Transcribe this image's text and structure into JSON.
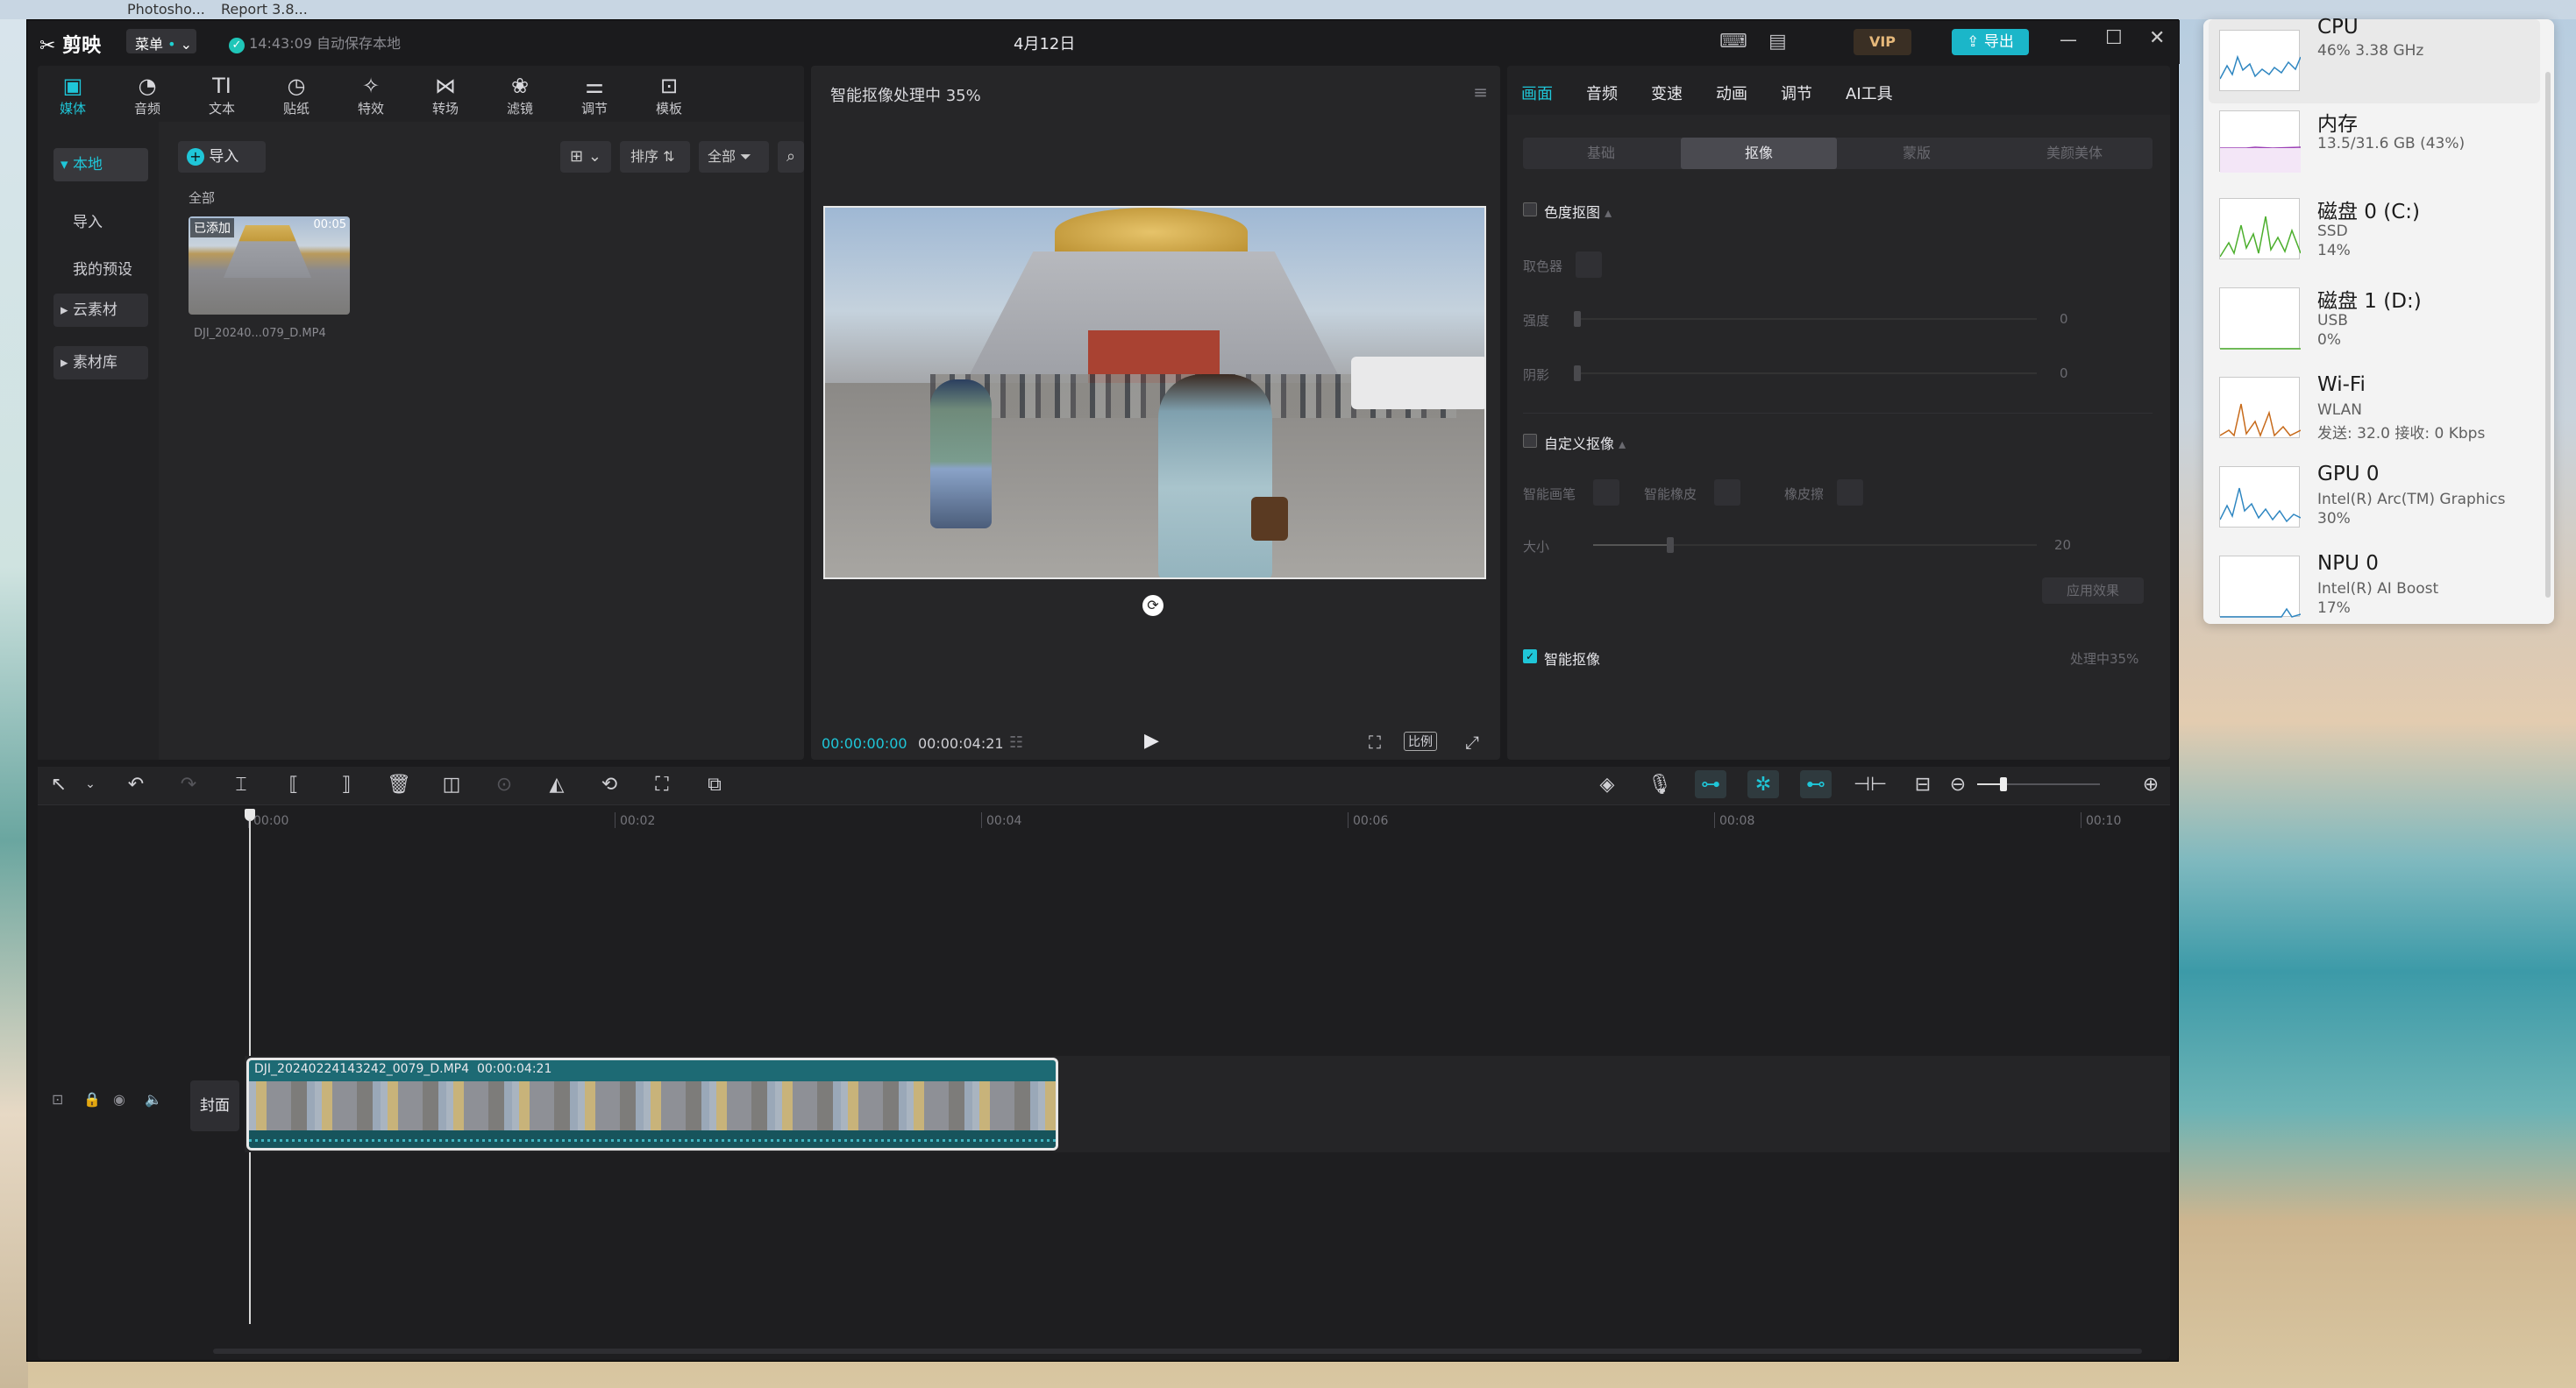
{
  "desktop": {
    "top_labels": [
      "Photosho...",
      "Report 3.8..."
    ]
  },
  "app": {
    "name": "剪映",
    "menu_label": "菜单",
    "autosave": "14:43:09 自动保存本地",
    "date_title": "4月12日",
    "vip": "VIP",
    "export": "导出"
  },
  "toolbar": [
    {
      "icon": "media-icon",
      "glyph": "▣",
      "label": "媒体"
    },
    {
      "icon": "audio-icon",
      "glyph": "◔",
      "label": "音频"
    },
    {
      "icon": "text-icon",
      "glyph": "TI",
      "label": "文本"
    },
    {
      "icon": "sticker-icon",
      "glyph": "◷",
      "label": "贴纸"
    },
    {
      "icon": "effects-icon",
      "glyph": "✧",
      "label": "特效"
    },
    {
      "icon": "transition-icon",
      "glyph": "⋈",
      "label": "转场"
    },
    {
      "icon": "filter-icon",
      "glyph": "❀",
      "label": "滤镜"
    },
    {
      "icon": "adjust-icon",
      "glyph": "⚌",
      "label": "调节"
    },
    {
      "icon": "template-icon",
      "glyph": "⊡",
      "label": "模板"
    }
  ],
  "sidebar": [
    {
      "label": "本地",
      "active": true
    },
    {
      "label": "导入"
    },
    {
      "label": "我的预设"
    },
    {
      "label": "云素材"
    },
    {
      "label": "素材库"
    }
  ],
  "media": {
    "import": "导入",
    "sort": "排序",
    "filter_all": "全部",
    "section": "全部",
    "clip_badge": "已添加",
    "clip_duration": "00:05",
    "clip_name": "DJI_20240...079_D.MP4"
  },
  "player": {
    "title": "智能抠像处理中 35%",
    "time_current": "00:00:00:00",
    "time_total": "00:00:04:21",
    "ratio": "比例"
  },
  "inspector": {
    "tabs": [
      "画面",
      "音频",
      "变速",
      "动画",
      "调节",
      "AI工具"
    ],
    "subtabs": [
      "基础",
      "抠像",
      "蒙版",
      "美颜美体"
    ],
    "chroma_title": "色度抠图",
    "pick_color": "取色器",
    "strength": "强度",
    "shadow": "阴影",
    "strength_val": "0",
    "shadow_val": "0",
    "custom_title": "自定义抠像",
    "smart_brush": "智能画笔",
    "smart_eraser": "智能橡皮",
    "eraser": "橡皮擦",
    "size": "大小",
    "size_val": "20",
    "apply": "应用效果",
    "smart_cutout": "智能抠像",
    "progress": "处理中35%"
  },
  "timeline": {
    "ticks": [
      "00:00",
      "00:02",
      "00:04",
      "00:06",
      "00:08",
      "00:10"
    ],
    "cover": "封面",
    "clip_name": "DJI_20240224143242_0079_D.MP4",
    "clip_duration": "00:00:04:21"
  },
  "taskmgr": [
    {
      "name": "CPU",
      "sub": [
        "46% 3.38 GHz"
      ],
      "color": "#2e86c1"
    },
    {
      "name": "内存",
      "sub": [
        "13.5/31.6 GB (43%)"
      ],
      "color": "#9b3fb5"
    },
    {
      "name": "磁盘 0 (C:)",
      "sub": [
        "SSD",
        "14%"
      ],
      "color": "#4caf2d"
    },
    {
      "name": "磁盘 1 (D:)",
      "sub": [
        "USB",
        "0%"
      ],
      "color": "#4caf2d"
    },
    {
      "name": "Wi-Fi",
      "sub": [
        "WLAN",
        "发送: 32.0 接收: 0 Kbps"
      ],
      "color": "#c76a1a"
    },
    {
      "name": "GPU 0",
      "sub": [
        "Intel(R) Arc(TM) Graphics",
        "30%"
      ],
      "color": "#2e86c1"
    },
    {
      "name": "NPU 0",
      "sub": [
        "Intel(R) AI Boost",
        "17%"
      ],
      "color": "#2e86c1"
    }
  ]
}
